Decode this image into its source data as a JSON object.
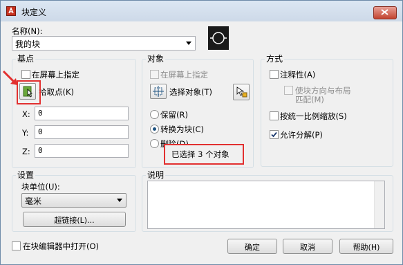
{
  "title": "块定义",
  "name_label": "名称(N):",
  "name_value": "我的块",
  "groups": {
    "base_point": "基点",
    "objects": "对象",
    "behavior": "方式",
    "settings": "设置",
    "description": "说明"
  },
  "base": {
    "specify_on_screen": "在屏幕上指定",
    "pick_point": "拾取点(K)",
    "x_label": "X:",
    "x_value": "0",
    "y_label": "Y:",
    "y_value": "0",
    "z_label": "Z:",
    "z_value": "0"
  },
  "objects": {
    "specify_on_screen": "在屏幕上指定",
    "select_objects": "选择对象(T)",
    "retain": "保留(R)",
    "convert": "转换为块(C)",
    "delete": "删除(D)",
    "selected_status": "已选择 3 个对象"
  },
  "behavior": {
    "annotative": "注释性(A)",
    "match_orientation_1": "使块方向与布局",
    "match_orientation_2": "匹配(M)",
    "scale_uniformly": "按统一比例缩放(S)",
    "allow_exploding": "允许分解(P)"
  },
  "settings": {
    "block_unit_label": "块单位(U):",
    "block_unit_value": "毫米",
    "hyperlink": "超链接(L)..."
  },
  "open_in_editor": "在块编辑器中打开(O)",
  "buttons": {
    "ok": "确定",
    "cancel": "取消",
    "help": "帮助(H)"
  },
  "colors": {
    "annotation_red": "#e23030",
    "title_bar": "#dce7f3"
  }
}
